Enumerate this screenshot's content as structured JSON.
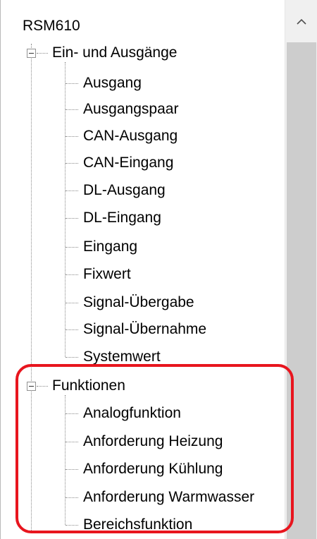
{
  "tree": {
    "root_label": "RSM610",
    "groups": [
      {
        "label": "Ein- und Ausgänge",
        "children": [
          "Ausgang",
          "Ausgangspaar",
          "CAN-Ausgang",
          "CAN-Eingang",
          "DL-Ausgang",
          "DL-Eingang",
          "Eingang",
          "Fixwert",
          "Signal-Übergabe",
          "Signal-Übernahme",
          "Systemwert"
        ]
      },
      {
        "label": "Funktionen",
        "children": [
          "Analogfunktion",
          "Anforderung Heizung",
          "Anforderung Kühlung",
          "Anforderung Warmwasser",
          "Bereichsfunktion"
        ]
      }
    ]
  },
  "annotation": {
    "color": "#e8151e"
  },
  "icons": {
    "scroll_up": "chevron-up-icon",
    "expander": "collapse-minus-icon"
  }
}
